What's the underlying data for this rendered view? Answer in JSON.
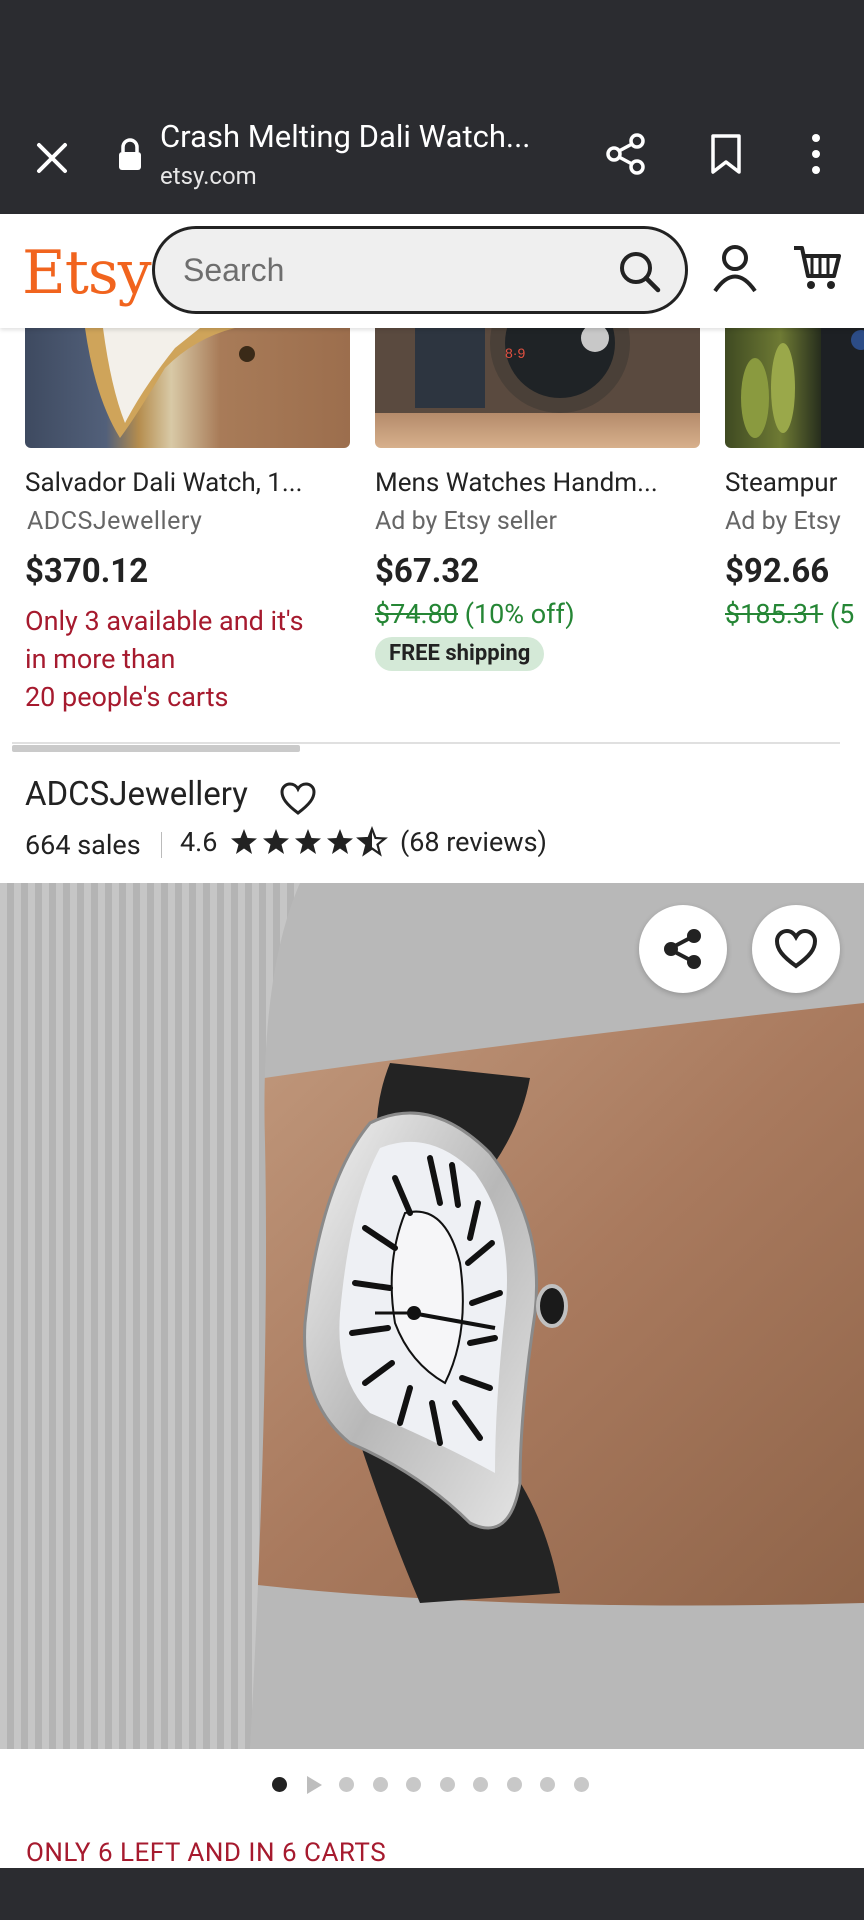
{
  "browser": {
    "title": "Crash Melting Dali Watch...",
    "url": "etsy.com"
  },
  "header": {
    "logo": "Etsy",
    "search_placeholder": "Search"
  },
  "products": [
    {
      "title": "Salvador Dali Watch, 1...",
      "shop": "ADCSJewellery",
      "price": "$370.12",
      "note_lines": [
        "Only 3 available and it's",
        "in more than",
        "20 people's carts"
      ]
    },
    {
      "title": "Mens Watches Handm...",
      "shop": "Ad by Etsy seller",
      "price": "$67.32",
      "original_price": "$74.80",
      "discount": "(10% off)",
      "badge": "FREE shipping"
    },
    {
      "title": "Steampur",
      "shop": "Ad by Etsy",
      "price": "$92.66",
      "original_price": "$185.31",
      "discount": "(5"
    }
  ],
  "shop": {
    "name": "ADCSJewellery",
    "sales": "664 sales",
    "rating": "4.6",
    "stars": 4.5,
    "reviews": "(68 reviews)"
  },
  "carousel": {
    "total": 10,
    "active": 0
  },
  "stock_notice": "ONLY 6 LEFT AND IN 6 CARTS",
  "colors": {
    "brand": "#f1641e",
    "urgent": "#a61a2e",
    "sale": "#258635",
    "badge_bg": "#d4e9d7"
  }
}
